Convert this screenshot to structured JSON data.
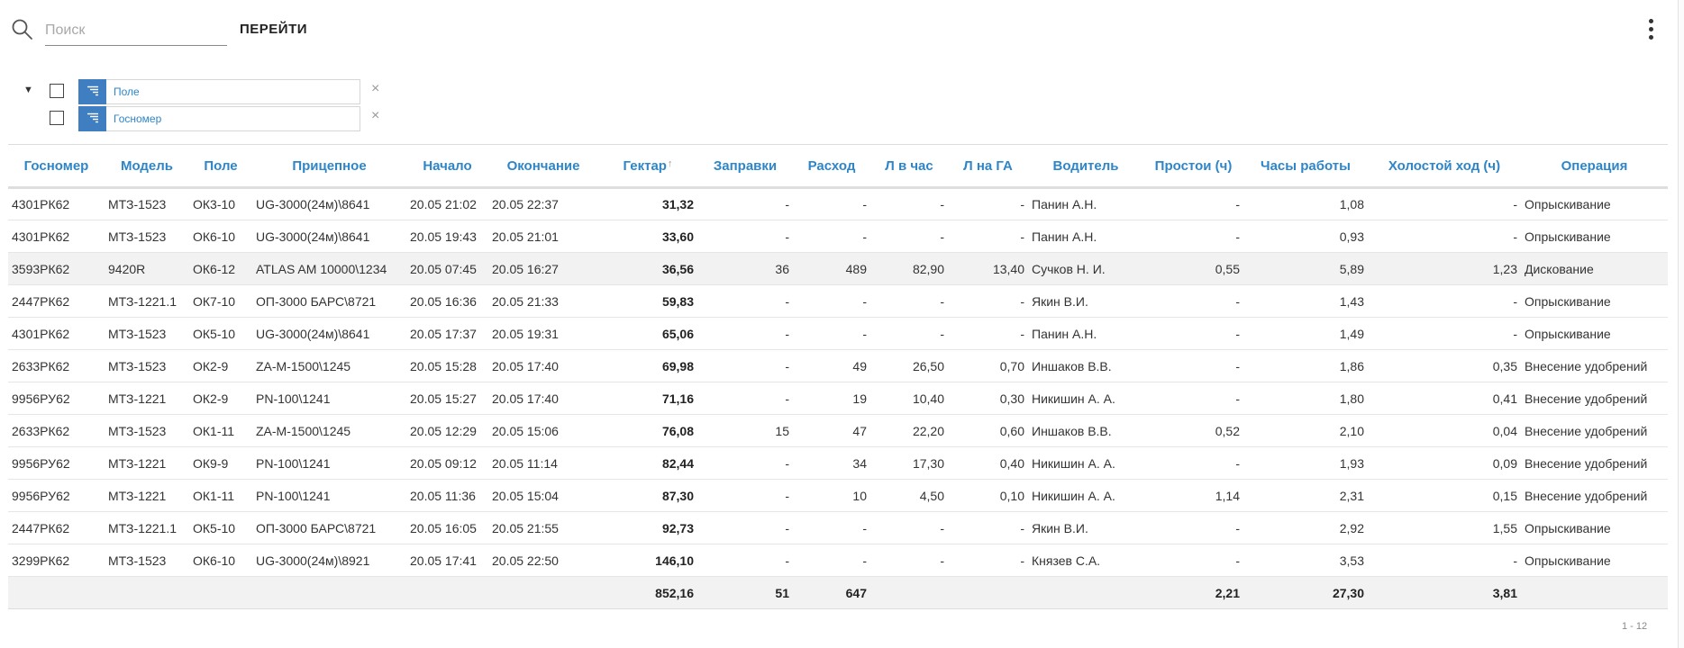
{
  "search": {
    "placeholder": "Поиск"
  },
  "toolbar": {
    "go_label": "ПЕРЕЙТИ"
  },
  "grouping": [
    {
      "label": "Поле",
      "remove": "×"
    },
    {
      "label": "Госномер",
      "remove": "×"
    }
  ],
  "table": {
    "columns": [
      "Госномер",
      "Модель",
      "Поле",
      "Прицепное",
      "Начало",
      "Окончание",
      "Гектар",
      "Заправки",
      "Расход",
      "Л в час",
      "Л на ГА",
      "Водитель",
      "Простои (ч)",
      "Часы работы",
      "Холостой ход (ч)",
      "Операция"
    ],
    "sort_indicator": "↑",
    "rows": [
      [
        "4301РК62",
        "МТЗ-1523",
        "ОК3-10",
        "UG-3000(24м)\\8641",
        "20.05 21:02",
        "20.05 22:37",
        "31,32",
        "-",
        "-",
        "-",
        "-",
        "Панин А.Н.",
        "-",
        "1,08",
        "-",
        "Опрыскивание"
      ],
      [
        "4301РК62",
        "МТЗ-1523",
        "ОК6-10",
        "UG-3000(24м)\\8641",
        "20.05 19:43",
        "20.05 21:01",
        "33,60",
        "-",
        "-",
        "-",
        "-",
        "Панин А.Н.",
        "-",
        "0,93",
        "-",
        "Опрыскивание"
      ],
      [
        "3593РК62",
        "9420R",
        "ОК6-12",
        "ATLAS AM 10000\\1234",
        "20.05 07:45",
        "20.05 16:27",
        "36,56",
        "36",
        "489",
        "82,90",
        "13,40",
        "Сучков Н. И.",
        "0,55",
        "5,89",
        "1,23",
        "Дискование"
      ],
      [
        "2447РК62",
        "МТЗ-1221.1",
        "ОК7-10",
        "ОП-3000 БАРС\\8721",
        "20.05 16:36",
        "20.05 21:33",
        "59,83",
        "-",
        "-",
        "-",
        "-",
        "Якин В.И.",
        "-",
        "1,43",
        "-",
        "Опрыскивание"
      ],
      [
        "4301РК62",
        "МТЗ-1523",
        "ОК5-10",
        "UG-3000(24м)\\8641",
        "20.05 17:37",
        "20.05 19:31",
        "65,06",
        "-",
        "-",
        "-",
        "-",
        "Панин А.Н.",
        "-",
        "1,49",
        "-",
        "Опрыскивание"
      ],
      [
        "2633РК62",
        "МТЗ-1523",
        "ОК2-9",
        "ZA-M-1500\\1245",
        "20.05 15:28",
        "20.05 17:40",
        "69,98",
        "-",
        "49",
        "26,50",
        "0,70",
        "Иншаков В.В.",
        "-",
        "1,86",
        "0,35",
        "Внесение удобрений"
      ],
      [
        "9956РУ62",
        "МТЗ-1221",
        "ОК2-9",
        "PN-100\\1241",
        "20.05 15:27",
        "20.05 17:40",
        "71,16",
        "-",
        "19",
        "10,40",
        "0,30",
        "Никишин А. А.",
        "-",
        "1,80",
        "0,41",
        "Внесение удобрений"
      ],
      [
        "2633РК62",
        "МТЗ-1523",
        "ОК1-11",
        "ZA-M-1500\\1245",
        "20.05 12:29",
        "20.05 15:06",
        "76,08",
        "15",
        "47",
        "22,20",
        "0,60",
        "Иншаков В.В.",
        "0,52",
        "2,10",
        "0,04",
        "Внесение удобрений"
      ],
      [
        "9956РУ62",
        "МТЗ-1221",
        "ОК9-9",
        "PN-100\\1241",
        "20.05 09:12",
        "20.05 11:14",
        "82,44",
        "-",
        "34",
        "17,30",
        "0,40",
        "Никишин А. А.",
        "-",
        "1,93",
        "0,09",
        "Внесение удобрений"
      ],
      [
        "9956РУ62",
        "МТЗ-1221",
        "ОК1-11",
        "PN-100\\1241",
        "20.05 11:36",
        "20.05 15:04",
        "87,30",
        "-",
        "10",
        "4,50",
        "0,10",
        "Никишин А. А.",
        "1,14",
        "2,31",
        "0,15",
        "Внесение удобрений"
      ],
      [
        "2447РК62",
        "МТЗ-1221.1",
        "ОК5-10",
        "ОП-3000 БАРС\\8721",
        "20.05 16:05",
        "20.05 21:55",
        "92,73",
        "-",
        "-",
        "-",
        "-",
        "Якин В.И.",
        "-",
        "2,92",
        "1,55",
        "Опрыскивание"
      ],
      [
        "3299РК62",
        "МТЗ-1523",
        "ОК6-10",
        "UG-3000(24м)\\8921",
        "20.05 17:41",
        "20.05 22:50",
        "146,10",
        "-",
        "-",
        "-",
        "-",
        "Князев С.А.",
        "-",
        "3,53",
        "-",
        "Опрыскивание"
      ]
    ],
    "totals": [
      "",
      "",
      "",
      "",
      "",
      "",
      "852,16",
      "51",
      "647",
      "",
      "",
      "",
      "2,21",
      "27,30",
      "3,81",
      ""
    ]
  },
  "pager": {
    "range": "1 - 12"
  }
}
